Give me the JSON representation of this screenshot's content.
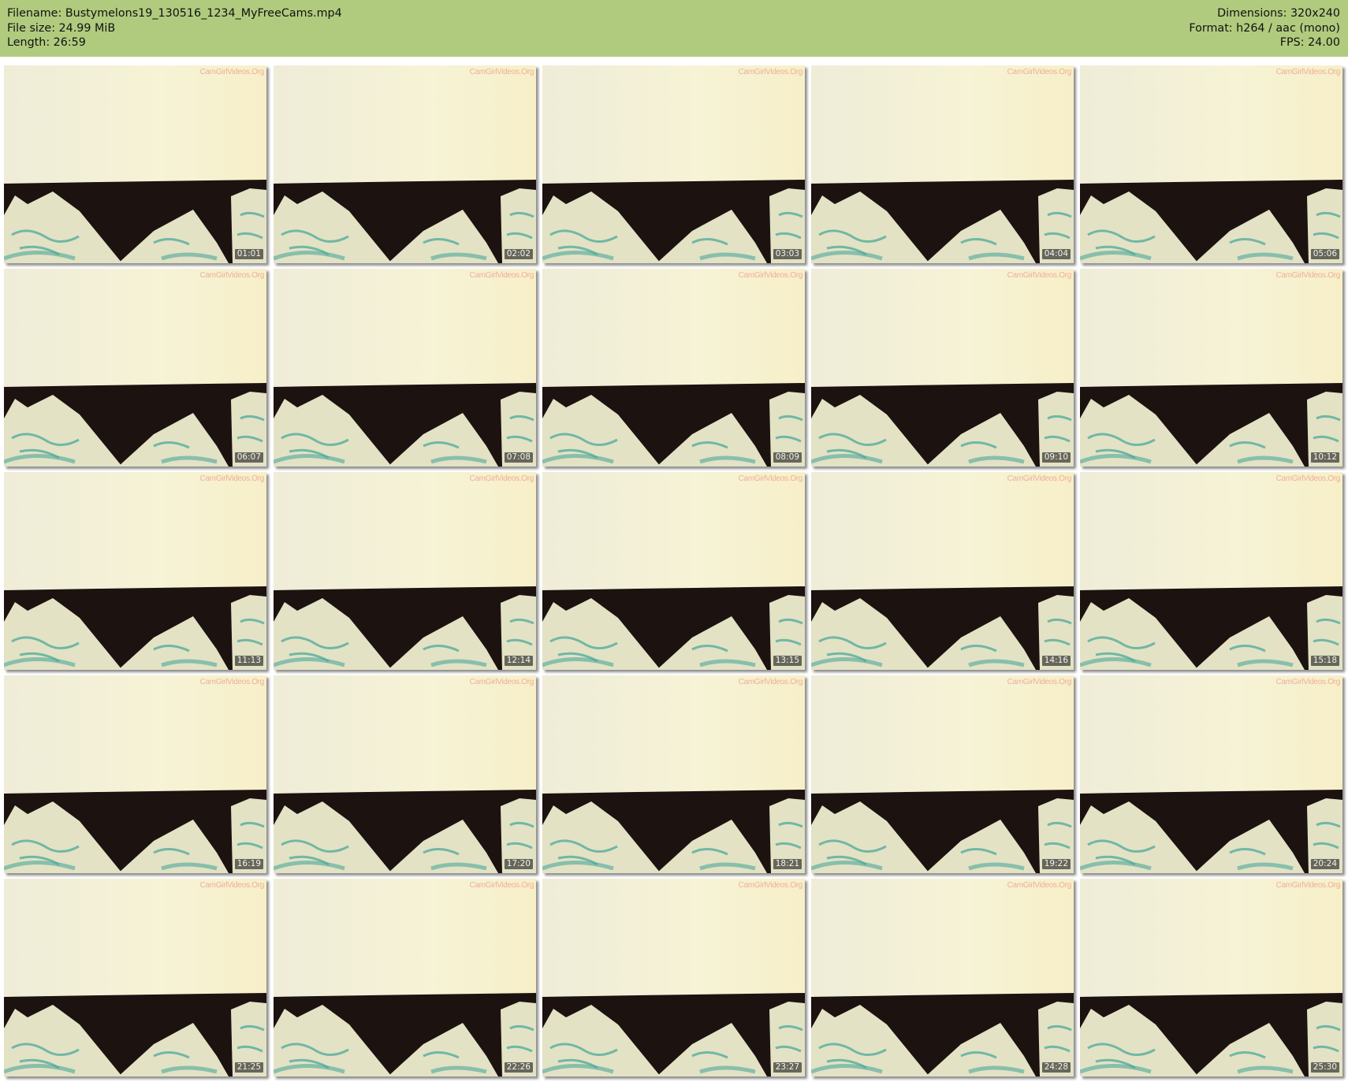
{
  "header": {
    "filename_line": "Filename: Bustymelons19_130516_1234_MyFreeCams.mp4",
    "filesize_line": "File size: 24.99 MiB",
    "length_line": "Length: 26:59",
    "dimensions_line": "Dimensions: 320x240",
    "format_line": "Format: h264 / aac (mono)",
    "fps_line": "FPS: 24.00"
  },
  "colors": {
    "header_bg": "#b0cb7e",
    "wall": "#f6f3d6",
    "sofa": "#1c1210",
    "pillow": "#e3e2c5",
    "pillow_print": "#4ba89a"
  },
  "watermark": "CamGirlVideos.Org",
  "thumbnails": [
    "01:01",
    "02:02",
    "03:03",
    "04:04",
    "05:06",
    "06:07",
    "07:08",
    "08:09",
    "09:10",
    "10:12",
    "11:13",
    "12:14",
    "13:15",
    "14:16",
    "15:18",
    "16:19",
    "17:20",
    "18:21",
    "19:22",
    "20:24",
    "21:25",
    "22:26",
    "23:27",
    "24:28",
    "25:30"
  ]
}
